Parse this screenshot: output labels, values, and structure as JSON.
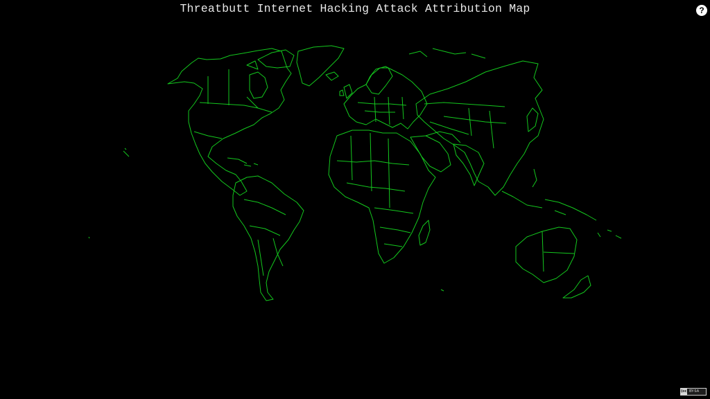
{
  "page": {
    "title": "Threatbutt Internet Hacking Attack Attribution Map"
  },
  "help_button": {
    "label": "?",
    "icon": "help-icon"
  },
  "map": {
    "background_color": "#000000",
    "outline_color": "#14c81e",
    "icon": "world-map-outline"
  },
  "license_badge": {
    "icon": "creative-commons-icon",
    "cc_label": "(cc)",
    "terms_label": "BY-SA"
  }
}
